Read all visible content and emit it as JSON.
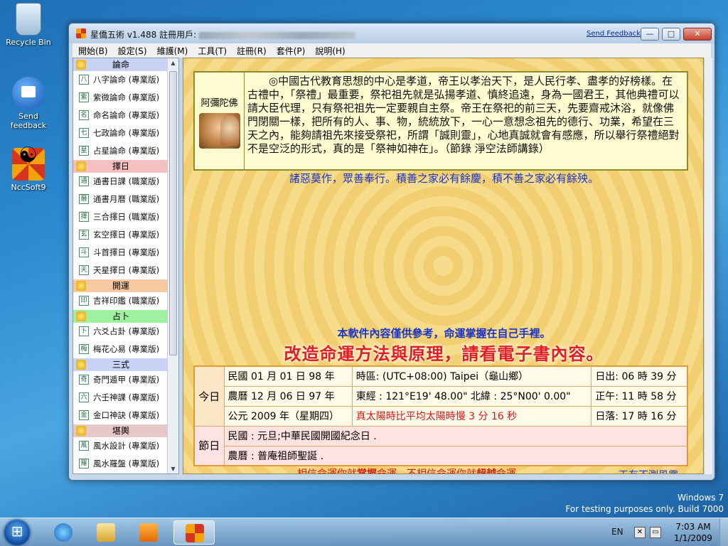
{
  "desktop": {
    "icons": [
      {
        "label": "Recycle Bin"
      },
      {
        "label": "Send\nfeedback"
      },
      {
        "label": "NccSoft9"
      }
    ],
    "watermark_line1": "Windows 7",
    "watermark_line2": "For testing purposes only. Build 7000"
  },
  "window": {
    "title": "星僑五術 v1.488  註冊用戶:",
    "send_feedback": "Send Feedback",
    "buttons": {
      "minimize": "—",
      "maximize": "□",
      "close": "✕"
    }
  },
  "menu": [
    "開始(B)",
    "設定(S)",
    "維護(M)",
    "工具(T)",
    "註冊(R)",
    "套件(P)",
    "說明(H)"
  ],
  "sidebar": {
    "sections": [
      {
        "title": "論命",
        "color": "#c8d2f5",
        "items": [
          {
            "icon": "八",
            "label": "八字論命 (專業版)"
          },
          {
            "icon": "紫",
            "label": "紫微論命 (專業版)"
          },
          {
            "icon": "名",
            "label": "命名論命 (專業版)"
          },
          {
            "icon": "七",
            "label": "七政論命 (專業版)"
          },
          {
            "icon": "星",
            "label": "占星論命 (專業版)"
          }
        ]
      },
      {
        "title": "擇日",
        "color": "#f7c0c0",
        "items": [
          {
            "icon": "通",
            "label": "通書日課 (職業版)"
          },
          {
            "icon": "曆",
            "label": "通書月曆 (職業版)"
          },
          {
            "icon": "擇",
            "label": "三合擇日 (職業版)"
          },
          {
            "icon": "玄",
            "label": "玄空擇日 (專業版)"
          },
          {
            "icon": "斗",
            "label": "斗首擇日 (專業版)"
          },
          {
            "icon": "天",
            "label": "天星擇日 (專業版)"
          }
        ]
      },
      {
        "title": "開運",
        "color": "#f7c9a0",
        "items": [
          {
            "icon": "印",
            "label": "吉祥印鑑 (職業版)"
          }
        ]
      },
      {
        "title": "占卜",
        "color": "#9ff09f",
        "items": [
          {
            "icon": "卜",
            "label": "六爻占卦 (專業版)"
          },
          {
            "icon": "梅",
            "label": "梅花心易 (專業版)"
          }
        ]
      },
      {
        "title": "三式",
        "color": "#c8d2f5",
        "items": [
          {
            "icon": "奇",
            "label": "奇門遁甲 (專業版)"
          },
          {
            "icon": "六",
            "label": "六壬神課 (專業版)"
          },
          {
            "icon": "金",
            "label": "金口神訣 (專業版)"
          }
        ]
      },
      {
        "title": "堪輿",
        "color": "#e7c8c8",
        "items": [
          {
            "icon": "風",
            "label": "風水設計 (專業版)"
          },
          {
            "icon": "羅",
            "label": "風水羅盤 (專業版)"
          }
        ]
      }
    ]
  },
  "content": {
    "quote_author": "阿彌陀佛",
    "quote_text": "◎中國古代教育思想的中心是孝道，帝王以孝治天下，是人民行孝、盡孝的好榜樣。在古禮中，「祭禮」最重要，祭祀祖先就是弘揚孝道、慎終追遠，身為一國君王，其他典禮可以請大臣代理，只有祭祀祖先一定要親自主祭。帝王在祭祀的前三天，先要齋戒沐浴，就像佛門閉關一樣，把所有的人、事、物，統統放下，一心一意想念祖先的德行、功業，希望在三天之內，能夠請祖先來接受祭祀，所謂「誠則靈」，心地真誠就會有感應，所以舉行祭禮絕對不是空泛的形式，真的是「祭神如神在」。（節錄 淨空法師講錄）",
    "motto1": "諸惡莫作，眾善奉行。積善之家必有餘慶，積不善之家必有餘殃。",
    "motto2": "本軟件內容僅供參考，命運掌握在自己手裡。",
    "motto3": "改造命運方法與原理，請看電子書內容。",
    "today_label": "今日",
    "festival_label": "節日",
    "rows": [
      [
        "民國 01 月 01 日 98 年",
        "時區: (UTC+08:00) Taipei（龜山鄉）",
        "日出: 06 時 39 分"
      ],
      [
        "農曆 12 月 06 日 97 年",
        "東經 : 121°E19' 48.00\" 北緯 : 25°N00' 0.00\"",
        "正午: 11 時 58 分"
      ],
      [
        "公元 2009 年（星期四）",
        "真太陽時比平均太陽時慢 3 分 16 秒",
        "日落: 17 時 16 分"
      ]
    ],
    "festival1": "民國 : 元旦;中華民國開國紀念日 .",
    "festival2": "農曆 : 普庵祖師聖誕 .",
    "footer_left_a": "相信命運你就",
    "footer_left_b": "掌握",
    "footer_left_c": "命運，不相信命運你就",
    "footer_left_d": "超越",
    "footer_left_e": "命運。",
    "footer_right": "天有不測風靈"
  },
  "taskbar": {
    "lang": "EN",
    "time": "7:03 AM",
    "date": "1/1/2009"
  }
}
